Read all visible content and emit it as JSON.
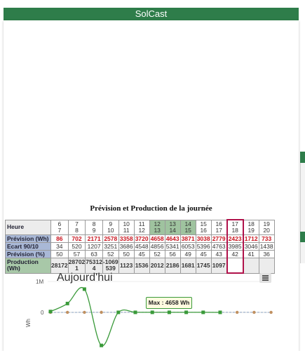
{
  "app": {
    "title": "SolCast"
  },
  "table": {
    "heading": "Prévision et Production de la journée",
    "row_labels": {
      "heure": "Heure",
      "prevision": "Prévision (Wh)",
      "ecart": "Ecart 90/10",
      "pct": "Prévision (%)",
      "production": "Production (Wh)"
    },
    "hours": [
      [
        "6",
        "7"
      ],
      [
        "7",
        "8"
      ],
      [
        "8",
        "9"
      ],
      [
        "9",
        "10"
      ],
      [
        "10",
        "11"
      ],
      [
        "11",
        "12"
      ],
      [
        "12",
        "13"
      ],
      [
        "13",
        "14"
      ],
      [
        "14",
        "15"
      ],
      [
        "15",
        "16"
      ],
      [
        "16",
        "17"
      ],
      [
        "17",
        "18"
      ],
      [
        "18",
        "19"
      ],
      [
        "19",
        "20"
      ]
    ],
    "prevision": [
      "86",
      "702",
      "2171",
      "2578",
      "3358",
      "3720",
      "4658",
      "4643",
      "3871",
      "3038",
      "2779",
      "2423",
      "1712",
      "733"
    ],
    "ecart": [
      "34",
      "520",
      "1207",
      "3251",
      "3686",
      "4548",
      "4856",
      "5341",
      "6053",
      "5396",
      "4763",
      "3985",
      "3046",
      "1438"
    ],
    "pct": [
      "50",
      "57",
      "63",
      "52",
      "50",
      "45",
      "52",
      "56",
      "49",
      "45",
      "43",
      "42",
      "41",
      "36"
    ],
    "production": [
      [
        "28172"
      ],
      [
        "28702",
        "1"
      ],
      [
        "75312",
        "4"
      ],
      [
        "-1069",
        "539"
      ],
      [
        "1123"
      ],
      [
        "1536"
      ],
      [
        "2012"
      ],
      [
        "2186"
      ],
      [
        "1681"
      ],
      [
        "1745"
      ],
      [
        "1097"
      ],
      [
        ""
      ],
      [
        ""
      ],
      [
        ""
      ]
    ],
    "highlight_cols": [
      6,
      7,
      8
    ],
    "current_col": 11
  },
  "chart": {
    "title": "Aujourd'hui",
    "menu_icon": "hamburger-menu-icon",
    "ylabel": "Wh",
    "yticks": [
      "1M",
      "0"
    ],
    "tooltip": "Max : 4658 Wh"
  },
  "colors": {
    "header_green": "#2e7d4a",
    "production": "#3a9a3a",
    "prevision": "#c09060",
    "current": "#b0124a"
  },
  "chart_data": {
    "type": "line",
    "title": "Aujourd'hui",
    "ylabel": "Wh",
    "yticks": [
      "1M",
      "0"
    ],
    "ylim": [
      -1000000,
      1000000
    ],
    "series": [
      {
        "values": [
          28172,
          287021,
          753124,
          -1069539,
          1123,
          1536,
          2012,
          2186,
          1681,
          1745,
          1097
        ]
      },
      {
        "values": [
          86,
          702,
          2171,
          2578,
          3358,
          3720,
          4658,
          4643,
          3871,
          3038,
          2779,
          2423,
          1712,
          733
        ]
      }
    ]
  }
}
